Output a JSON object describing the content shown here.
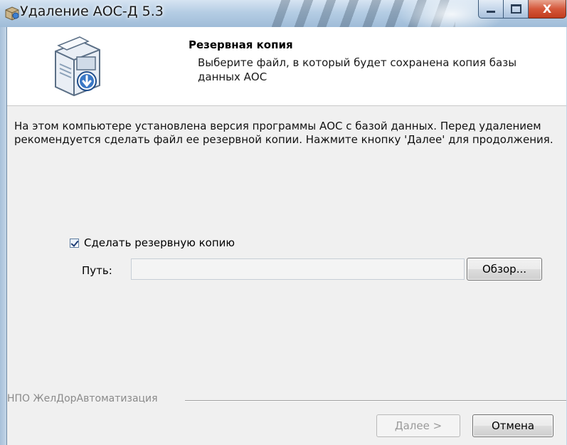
{
  "window": {
    "title": "Удаление АОС-Д 5.3",
    "app_icon": "installer-icon",
    "close_symbol": "X"
  },
  "header": {
    "title": "Резервная копия",
    "subtitle": "Выберите файл, в который будет сохранена копия базы данных АОС",
    "icon": "backup-box-icon"
  },
  "main": {
    "intro": "На этом компьютере установлена версия программы АОС с базой данных. Перед удалением рекомендуется сделать файл ее резервной копии. Нажмите кнопку 'Далее' для продолжения.",
    "backup_checkbox": {
      "label": "Сделать резервную копию",
      "checked": true
    },
    "path": {
      "label": "Путь:",
      "value": ""
    },
    "browse_label": "Обзор..."
  },
  "footer": {
    "company": "НПО ЖелДорАвтоматизация",
    "next_label": "Далее >",
    "cancel_label": "Отмена"
  }
}
